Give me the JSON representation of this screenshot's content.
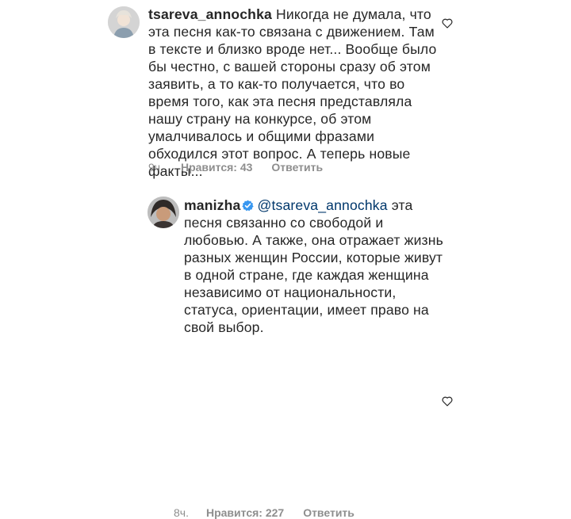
{
  "comments": [
    {
      "username": "tsareva_annochka",
      "text": "Никогда не думала, что эта песня как-то связана с движением. Там в тексте и близко вроде нет... Вообще было бы честно, с вашей стороны сразу об этом заявить, а то как-то получается, что во время того, как эта песня представляла нашу страну на конкурсе, об этом умалчивалось и общими фразами обходился этот вопрос. А теперь новые факты...",
      "time": "9ч.",
      "likes": "Нравится: 43",
      "reply": "Ответить",
      "icons": {
        "avatar": "user-avatar-icon",
        "like": "heart-outline-icon"
      }
    },
    {
      "username": "manizha",
      "verified": true,
      "mention": "@tsareva_annochka",
      "text": "эта песня связанно со свободой и любовью. А также, она отражает жизнь разных женщин России, которые живут в одной стране, где каждая женщина независимо от национальности, статуса, ориентации, имеет право на свой выбор.",
      "time": "8ч.",
      "likes": "Нравится: 227",
      "reply": "Ответить",
      "icons": {
        "avatar": "user-avatar-icon",
        "verified": "verified-badge-icon",
        "like": "heart-outline-icon"
      }
    }
  ],
  "colors": {
    "text": "#262626",
    "meta": "#8e8e8e",
    "mention": "#00376b",
    "verified": "#3897f0"
  }
}
